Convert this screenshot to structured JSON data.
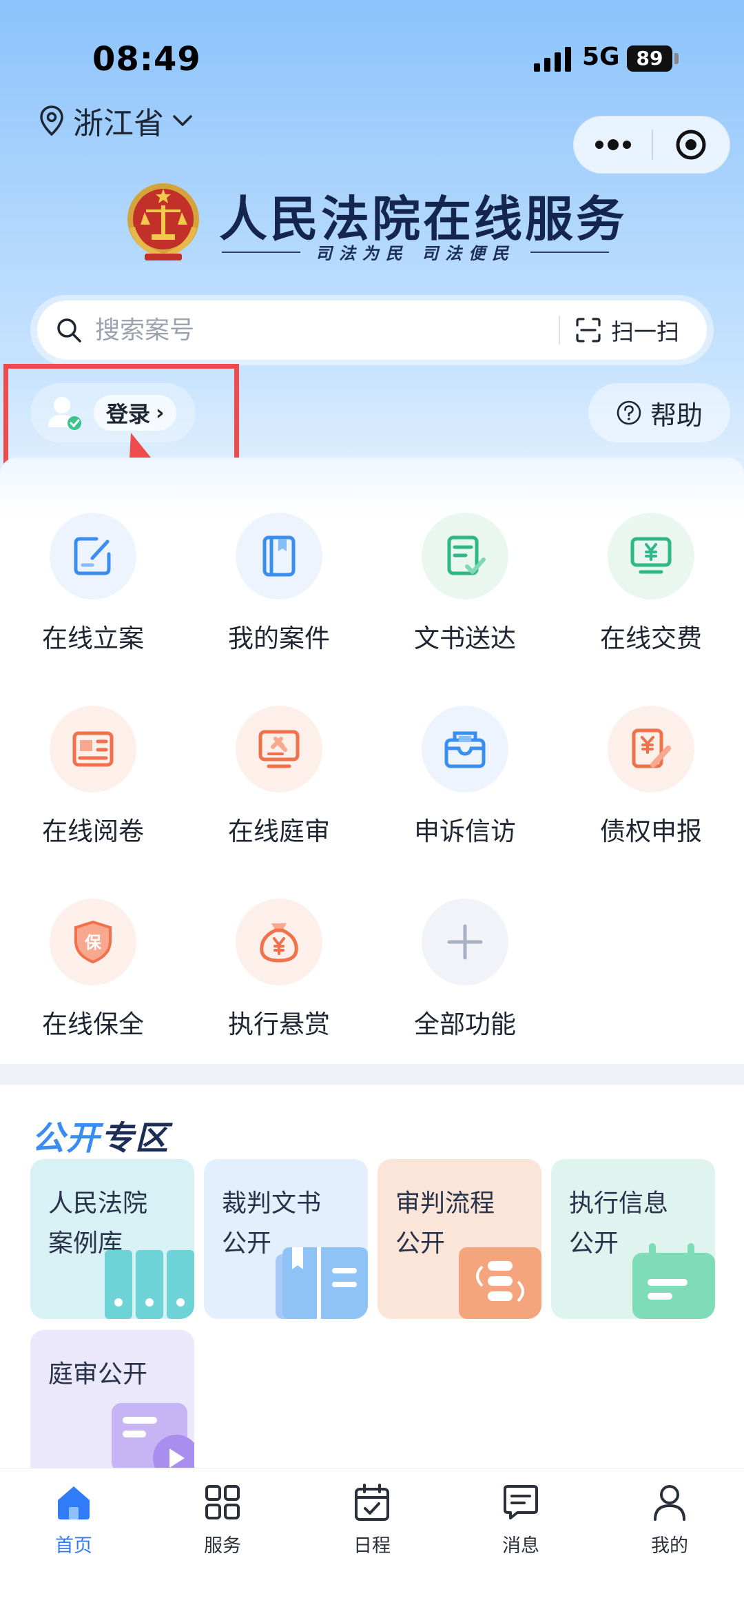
{
  "status_bar": {
    "time": "08:49",
    "network": "5G",
    "battery": "89"
  },
  "location": {
    "label": "浙江省"
  },
  "brand": {
    "title": "人民法院在线服务",
    "slogan": "司法为民   司法便民"
  },
  "search": {
    "placeholder": "搜索案号",
    "scan_label": "扫一扫"
  },
  "user": {
    "login_label": "登录",
    "help_label": "帮助"
  },
  "services": [
    {
      "label": "在线立案",
      "icon": "edit-document-icon",
      "color": "#3a8ef0"
    },
    {
      "label": "我的案件",
      "icon": "case-book-icon",
      "color": "#3a8ef0"
    },
    {
      "label": "文书送达",
      "icon": "document-check-icon",
      "color": "#2eb887"
    },
    {
      "label": "在线交费",
      "icon": "payment-monitor-icon",
      "color": "#2eb887"
    },
    {
      "label": "在线阅卷",
      "icon": "file-read-icon",
      "color": "#f0714a"
    },
    {
      "label": "在线庭审",
      "icon": "gavel-monitor-icon",
      "color": "#f0714a"
    },
    {
      "label": "申诉信访",
      "icon": "mailbox-icon",
      "color": "#3a8ef0"
    },
    {
      "label": "债权申报",
      "icon": "claim-edit-icon",
      "color": "#f0714a"
    },
    {
      "label": "在线保全",
      "icon": "shield-icon",
      "color": "#f0714a"
    },
    {
      "label": "执行悬赏",
      "icon": "money-bag-icon",
      "color": "#f0714a"
    },
    {
      "label": "全部功能",
      "icon": "plus-icon",
      "color": "#a9b0c2"
    }
  ],
  "public_zone": {
    "title_part1": "公开",
    "title_part2": "专区",
    "cards": [
      {
        "line1": "人民法院",
        "line2": "案例库",
        "bg": "#d8f1f4"
      },
      {
        "line1": "裁判文书",
        "line2": "公开",
        "bg": "#e3effc"
      },
      {
        "line1": "审判流程",
        "line2": "公开",
        "bg": "#fbe5d8"
      },
      {
        "line1": "执行信息",
        "line2": "公开",
        "bg": "#dff4ef"
      },
      {
        "line1": "庭审公开",
        "line2": "",
        "bg": "#ece8fb"
      }
    ]
  },
  "bottom_nav": [
    {
      "label": "首页",
      "active": true
    },
    {
      "label": "服务",
      "active": false
    },
    {
      "label": "日程",
      "active": false
    },
    {
      "label": "消息",
      "active": false
    },
    {
      "label": "我的",
      "active": false
    }
  ],
  "colors": {
    "accent": "#2f7cf6",
    "annotation": "#ee4c4c",
    "brand_navy": "#14264d"
  }
}
